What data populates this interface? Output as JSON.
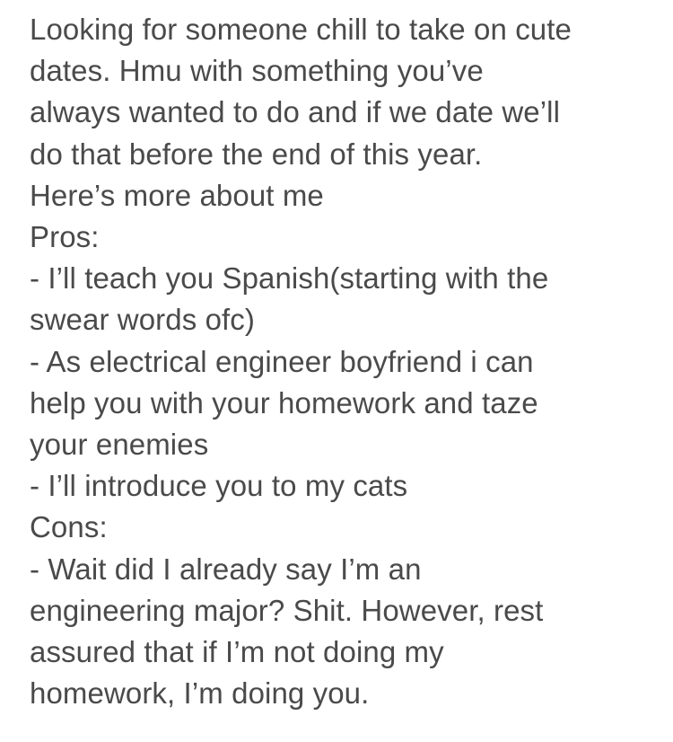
{
  "post": {
    "lines": [
      "Looking for someone chill to take on cute",
      "dates. Hmu with something you’ve",
      "always wanted to do and if we date we’ll",
      "do that before the end of this year.",
      "Here’s more about me",
      "Pros:",
      "- I’ll teach you Spanish(starting with the",
      "swear words ofc)",
      "- As electrical engineer boyfriend i can",
      "help you with your homework and taze",
      "your enemies",
      "- I’ll introduce you to my cats",
      "Cons:",
      "- Wait did I already say I’m an",
      "engineering major? Shit. However, rest",
      "assured that if I’m not doing my",
      "homework, I’m doing you."
    ]
  },
  "colors": {
    "background": "#ffffff",
    "text": "#4a4a4a"
  }
}
